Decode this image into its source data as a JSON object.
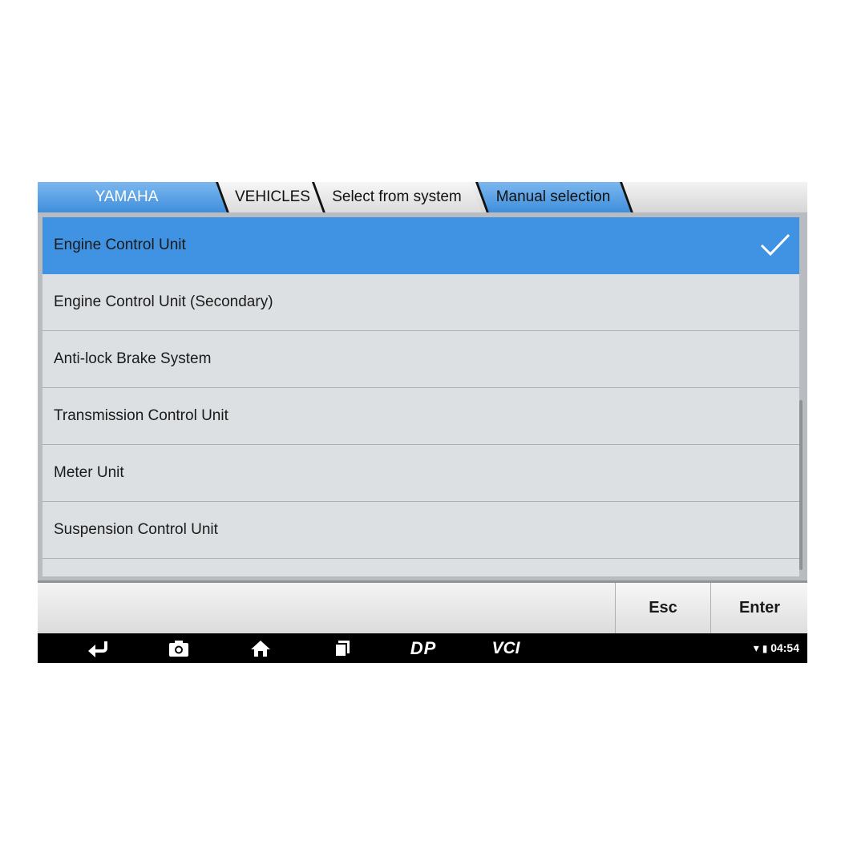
{
  "breadcrumbs": [
    {
      "label": "YAMAHA"
    },
    {
      "label": "VEHICLES"
    },
    {
      "label": "Select from system"
    },
    {
      "label": "Manual selection"
    }
  ],
  "list": {
    "items": [
      {
        "label": "Engine Control Unit",
        "selected": true
      },
      {
        "label": "Engine Control Unit (Secondary)"
      },
      {
        "label": "Anti-lock Brake System"
      },
      {
        "label": "Transmission Control Unit"
      },
      {
        "label": "Meter Unit"
      },
      {
        "label": "Suspension Control Unit"
      }
    ]
  },
  "actions": {
    "esc_label": "Esc",
    "enter_label": "Enter"
  },
  "navbar": {
    "icons": [
      "back-icon",
      "camera-icon",
      "home-icon",
      "recent-apps-icon",
      "dp-icon",
      "vci-icon"
    ],
    "dp_text": "DP",
    "vci_text": "VCI",
    "time": "04:54"
  },
  "colors": {
    "accent": "#3f93e2",
    "list_bg": "#dde0e3",
    "navbar_bg": "#000000"
  }
}
